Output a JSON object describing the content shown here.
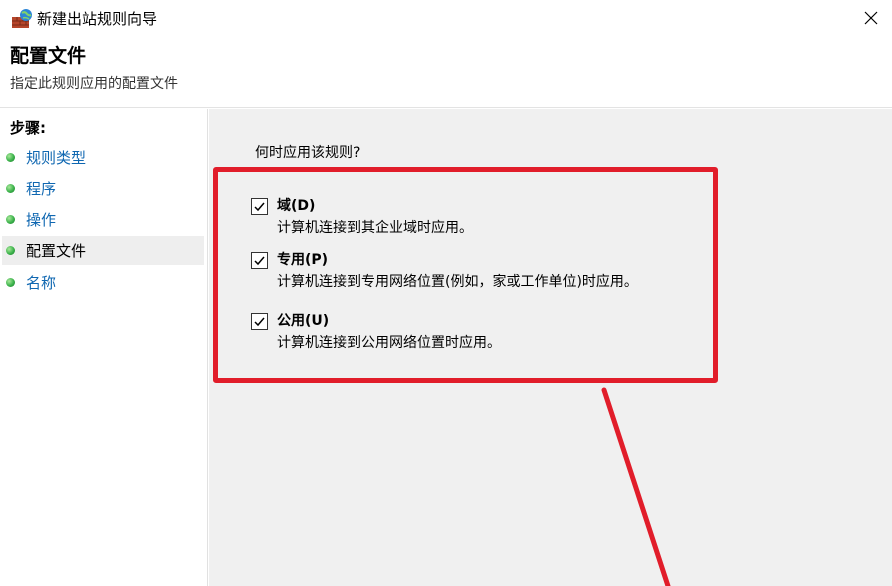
{
  "window": {
    "title": "新建出站规则向导",
    "icon": "firewall-icon",
    "close_icon": "close-icon"
  },
  "header": {
    "title": "配置文件",
    "subtitle": "指定此规则应用的配置文件"
  },
  "sidebar": {
    "steps_label": "步骤:",
    "items": [
      {
        "label": "规则类型",
        "active": false
      },
      {
        "label": "程序",
        "active": false
      },
      {
        "label": "操作",
        "active": false
      },
      {
        "label": "配置文件",
        "active": true
      },
      {
        "label": "名称",
        "active": false
      }
    ]
  },
  "main": {
    "question": "何时应用该规则?",
    "options": [
      {
        "title": "域(D)",
        "desc": "计算机连接到其企业域时应用。",
        "checked": true
      },
      {
        "title": "专用(P)",
        "desc": "计算机连接到专用网络位置(例如，家或工作单位)时应用。",
        "checked": true
      },
      {
        "title": "公用(U)",
        "desc": "计算机连接到公用网络位置时应用。",
        "checked": true
      }
    ]
  },
  "colors": {
    "annotation_red": "#e11d2a",
    "link_blue": "#0f67b1",
    "panel_gray": "#f0f0f0",
    "bullet_green": "#3bb24b"
  }
}
